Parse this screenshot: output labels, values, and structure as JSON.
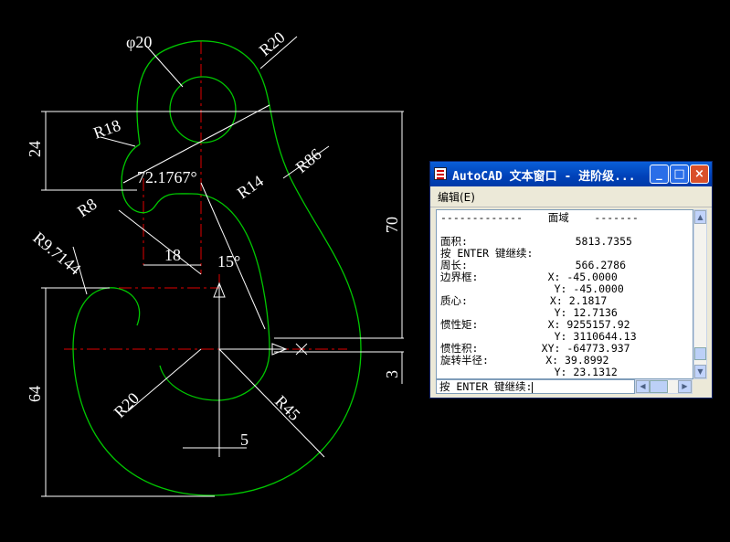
{
  "drawing": {
    "dimensions": {
      "phi20": "φ20",
      "r20_top": "R20",
      "r18": "R18",
      "r86": "R86",
      "angle": "72.1767°",
      "r14": "R14",
      "r8": "R8",
      "d24": "24",
      "d70": "70",
      "d18": "18",
      "a15": "15°",
      "r9_7144": "R9.7144",
      "d64": "64",
      "r20_bottom": "R20",
      "r45": "R45",
      "d5": "5",
      "d3": "3"
    },
    "colors": {
      "background": "#000000",
      "geometry": "#00c800",
      "centerline": "#e00000",
      "dimension": "#ffffff"
    }
  },
  "text_window": {
    "title": "AutoCAD 文本窗口 - 进阶级...",
    "menu_edit": "编辑(E)",
    "lines": [
      "-------------    面域    -------",
      "",
      "面积:                 5813.7355",
      "按 ENTER 键继续:",
      "周长:                 566.2786",
      "边界框:           X: -45.0000",
      "                  Y: -45.0000",
      "质心:             X: 2.1817",
      "                  Y: 12.7136",
      "惯性矩:           X: 9255157.92",
      "                  Y: 3110644.13",
      "惯性积:          XY: -64773.937",
      "旋转半径:         X: 39.8992",
      "                  Y: 23.1312"
    ],
    "command_prompt": "按 ENTER 键继续:",
    "buttons": {
      "minimize": "_",
      "maximize": "□",
      "close": "×"
    }
  }
}
